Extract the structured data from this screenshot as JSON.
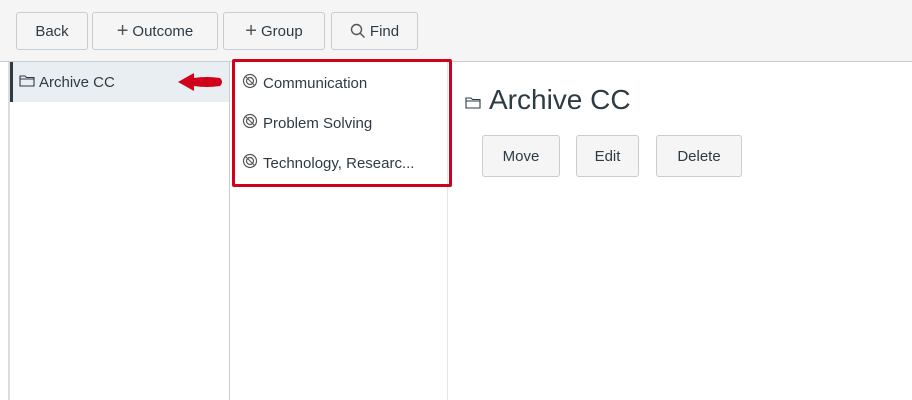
{
  "toolbar": {
    "back_label": "Back",
    "outcome_label": "Outcome",
    "group_label": "Group",
    "find_label": "Find"
  },
  "sidebar": {
    "items": [
      {
        "label": "Archive CC",
        "icon": "folder-icon",
        "selected": true
      }
    ]
  },
  "outcomes": {
    "items": [
      {
        "label": "Communication",
        "icon": "outcome-icon"
      },
      {
        "label": "Problem Solving",
        "icon": "outcome-icon"
      },
      {
        "label": "Technology, Researc...",
        "icon": "outcome-icon"
      }
    ]
  },
  "detail": {
    "title": "Archive CC",
    "move_label": "Move",
    "edit_label": "Edit",
    "delete_label": "Delete"
  },
  "annotation": {
    "highlight_color": "#d0021b",
    "arrow_color": "#d0021b"
  },
  "colors": {
    "selected_bg": "#e9eef3",
    "toolbar_bg": "#f5f5f5",
    "border": "#c7cdd1"
  }
}
